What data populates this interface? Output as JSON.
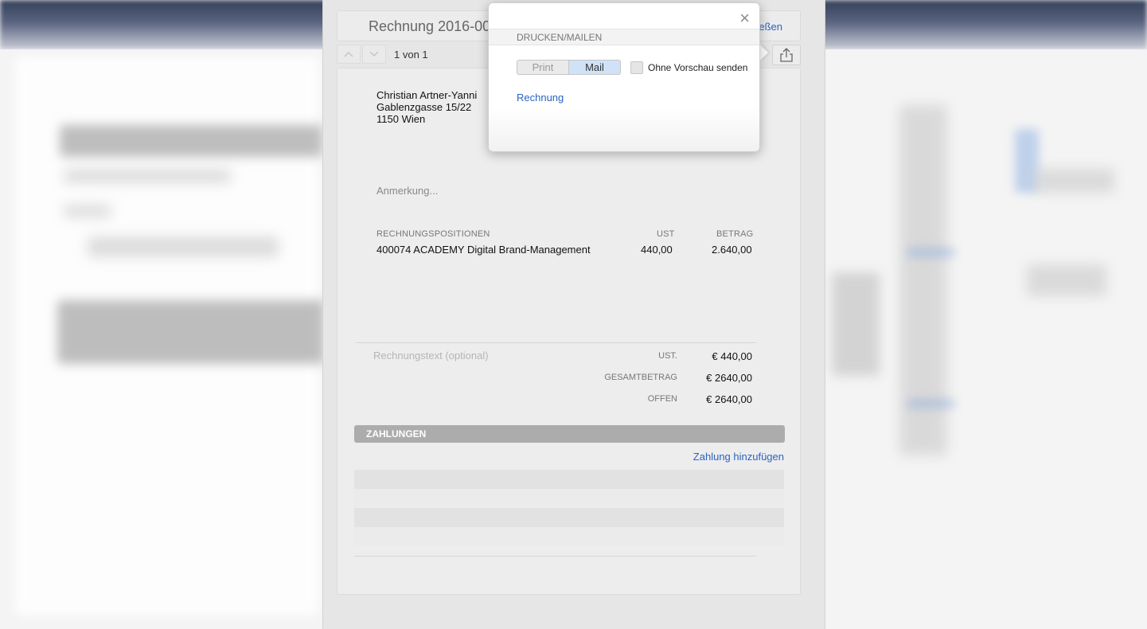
{
  "sheet": {
    "title": "Rechnung 2016-00",
    "close_label": "eßen",
    "pager": "1 von 1"
  },
  "address": {
    "name": "Christian Artner-Yanni",
    "street": "Gablenzgasse 15/22",
    "city": "1150 Wien"
  },
  "remark_placeholder": "Anmerkung...",
  "positions": {
    "headers": {
      "item": "RECHNUNGSPOSITIONEN",
      "vat": "UST",
      "amount": "BETRAG"
    },
    "rows": [
      {
        "item": "400074 ACADEMY Digital Brand-Management",
        "vat": "440,00",
        "amount": "2.640,00"
      }
    ]
  },
  "invoice_text_placeholder": "Rechnungstext (optional)",
  "summary": {
    "vat_label": "UST.",
    "vat_value": "€ 440,00",
    "total_label": "GESAMTBETRAG",
    "total_value": "€ 2640,00",
    "open_label": "OFFEN",
    "open_value": "€ 2640,00"
  },
  "payments": {
    "header": "ZAHLUNGEN",
    "add_label": "Zahlung hinzufügen"
  },
  "popover": {
    "close_icon": "×",
    "section": "DRUCKEN/MAILEN",
    "print_label": "Print",
    "mail_label": "Mail",
    "selected": "Mail",
    "no_preview_label": "Ohne Vorschau senden",
    "no_preview_checked": false,
    "document_link": "Rechnung"
  },
  "icons": {
    "nav_up": "chevron-up-icon",
    "nav_down": "chevron-down-icon",
    "share": "share-icon",
    "close": "close-icon"
  },
  "colors": {
    "link": "#2a63c4",
    "selected_segment": "#cfe2f7",
    "payments_bar": "#acacac"
  }
}
